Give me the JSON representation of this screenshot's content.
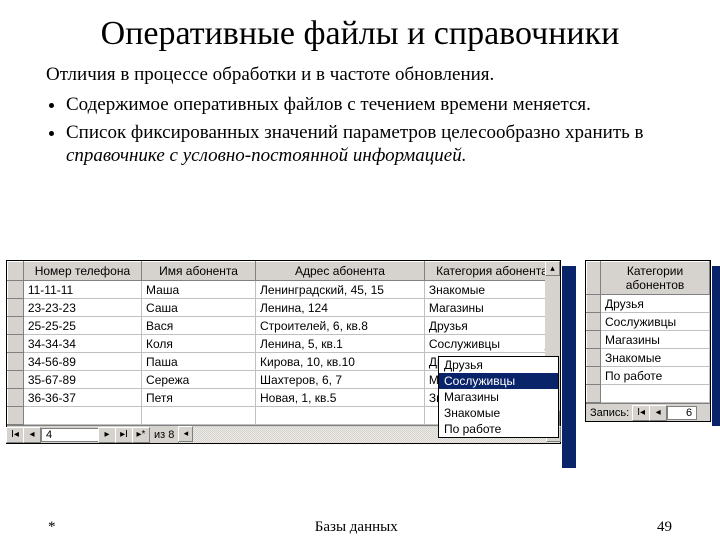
{
  "title": "Оперативные файлы и справочники",
  "intro": "Отличия в процессе обработки и в частоте обновления.",
  "bullets": [
    "Содержимое оперативных файлов с течением времени меняется.",
    "Список фиксированных значений параметров целесообразно хранить в "
  ],
  "bullet2_italic": "справочнике с условно-постоянной информацией.",
  "grid1": {
    "headers": [
      "Номер телефона",
      "Имя абонента",
      "Адрес абонента",
      "Категория абонента"
    ],
    "rows": [
      [
        "11-11-11",
        "Маша",
        "Ленинградский, 45, 15",
        "Знакомые"
      ],
      [
        "23-23-23",
        "Саша",
        "Ленина, 124",
        "Магазины"
      ],
      [
        "25-25-25",
        "Вася",
        "Строителей, 6, кв.8",
        "Друзья"
      ],
      [
        "34-34-34",
        "Коля",
        "Ленина, 5, кв.1",
        "Сослуживцы"
      ],
      [
        "34-56-89",
        "Паша",
        "Кирова, 10, кв.10",
        "Друзья"
      ],
      [
        "35-67-89",
        "Сережа",
        "Шахтеров, 6, 7",
        "Магазины"
      ],
      [
        "36-36-37",
        "Петя",
        "Новая, 1, кв.5",
        "Знакомые"
      ]
    ],
    "nav_current": "4",
    "nav_total": "из  8"
  },
  "dropdown": {
    "row_index": 3,
    "options": [
      "Друзья",
      "Сослуживцы",
      "Магазины",
      "Знакомые",
      "По работе"
    ],
    "selected": "Сослуживцы"
  },
  "grid2": {
    "header": "Категории абонентов",
    "rows": [
      "Друзья",
      "Сослуживцы",
      "Магазины",
      "Знакомые",
      "По работе"
    ],
    "nav_label": "Запись:",
    "nav_current": "6"
  },
  "glyphs": {
    "first": "I◂",
    "prev": "◂",
    "next": "▸",
    "last": "▸I",
    "new": "▸*",
    "up": "▴",
    "down": "▾",
    "left": "◂",
    "right": "▸"
  },
  "footer": {
    "left": "*",
    "center": "Базы данных",
    "right": "49"
  }
}
